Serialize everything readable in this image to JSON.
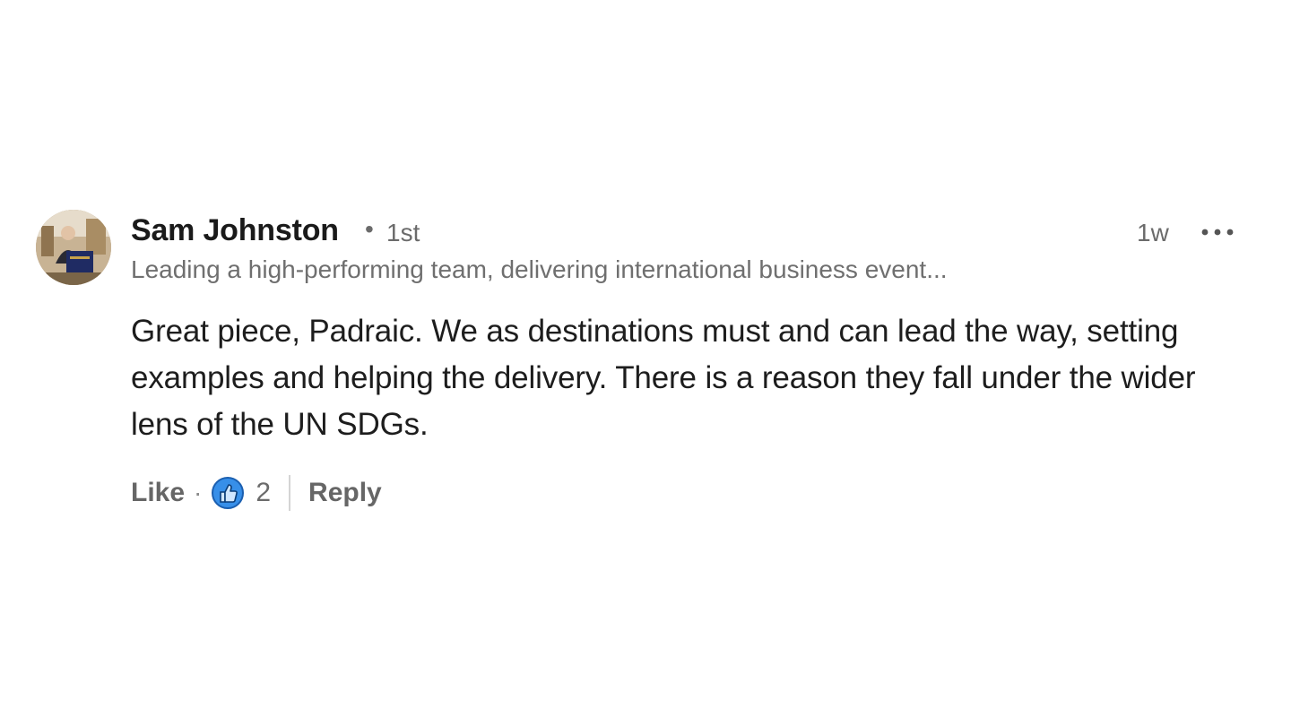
{
  "comment": {
    "author": {
      "name": "Sam Johnston",
      "degree_separator": "•",
      "degree": "1st",
      "headline": "Leading a high-performing team, delivering international business event..."
    },
    "timestamp": "1w",
    "more_icon": "more-horizontal-icon",
    "body": "Great piece, Padraic. We as destinations must and can lead the way, setting examples and helping the delivery. There is a reason they fall under the wider lens of the UN SDGs.",
    "actions": {
      "like_label": "Like",
      "separator": "·",
      "reaction_icon": "thumbs-up-icon",
      "reaction_count": "2",
      "reply_label": "Reply"
    }
  },
  "colors": {
    "text_primary": "#1d1d1d",
    "text_secondary": "#6b6b6b",
    "reaction_blue": "#378fe9"
  }
}
